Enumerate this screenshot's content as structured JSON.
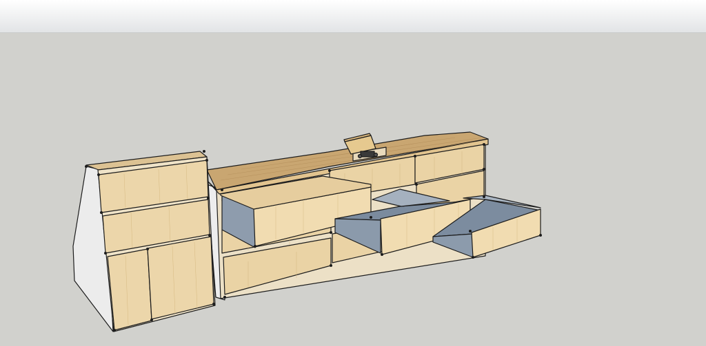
{
  "viewport": {
    "sky_color": "#eceeef",
    "ground_color": "#d1d1cd"
  },
  "model": {
    "subject": "workbench-with-drawers",
    "colors": {
      "wood_face": "#e9d2a4",
      "wood_light": "#f1dfb8",
      "wood_top": "#c9a671",
      "drawer_interior": "#7f8fa0",
      "drawer_inner_wall": "#a9b4c0",
      "side_panel": "#ebebeb",
      "edge": "#1c1c1c"
    },
    "drawers_open": 3,
    "drawers_closed": 11,
    "cabinet_doors": 2
  }
}
